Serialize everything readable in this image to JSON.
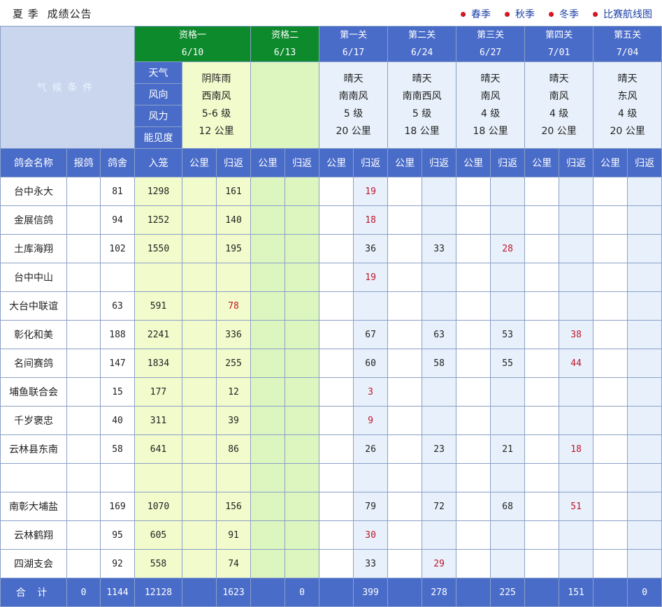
{
  "header": {
    "title_a": "夏 季",
    "title_b": "成绩公告",
    "nav": [
      "春季",
      "秋季",
      "冬季",
      "比赛航线图"
    ]
  },
  "stages": [
    {
      "name": "资格一",
      "date": "6/10"
    },
    {
      "name": "资格二",
      "date": "6/13"
    },
    {
      "name": "第一关",
      "date": "6/17"
    },
    {
      "name": "第二关",
      "date": "6/24"
    },
    {
      "name": "第三关",
      "date": "6/27"
    },
    {
      "name": "第四关",
      "date": "7/01"
    },
    {
      "name": "第五关",
      "date": "7/04"
    }
  ],
  "conditions_label": "气候条件",
  "weather_labels": [
    "天气",
    "风向",
    "风力",
    "能见度"
  ],
  "weather": [
    [
      "阴阵雨",
      "西南风",
      "5-6 级",
      "12 公里"
    ],
    [
      "",
      "",
      "",
      ""
    ],
    [
      "晴天",
      "南南风",
      "5 级",
      "20 公里"
    ],
    [
      "晴天",
      "南南西风",
      "5 级",
      "18 公里"
    ],
    [
      "晴天",
      "南风",
      "4 级",
      "18 公里"
    ],
    [
      "晴天",
      "南风",
      "4 级",
      "20 公里"
    ],
    [
      "晴天",
      "东风",
      "4 级",
      "20 公里"
    ]
  ],
  "columns": {
    "club": "鸽会名称",
    "registered": "报鸽",
    "lofts": "鸽舍",
    "entered": "入笼",
    "km": "公里",
    "returned": "归返"
  },
  "rows": [
    [
      "台中永大",
      "",
      "81",
      "1298",
      "",
      "161",
      "",
      "",
      "",
      "19",
      "",
      "",
      "",
      "",
      "",
      "",
      "",
      ""
    ],
    [
      "金展信鸽",
      "",
      "94",
      "1252",
      "",
      "140",
      "",
      "",
      "",
      "18",
      "",
      "",
      "",
      "",
      "",
      "",
      "",
      ""
    ],
    [
      "土库海翔",
      "",
      "102",
      "1550",
      "",
      "195",
      "",
      "",
      "",
      "36",
      "",
      "33",
      "",
      "28",
      "",
      "",
      "",
      ""
    ],
    [
      "台中中山",
      "",
      "",
      "",
      "",
      "",
      "",
      "",
      "",
      "19",
      "",
      "",
      "",
      "",
      "",
      "",
      "",
      ""
    ],
    [
      "大台中联谊",
      "",
      "63",
      "591",
      "",
      "78",
      "",
      "",
      "",
      "",
      "",
      "",
      "",
      "",
      "",
      "",
      "",
      ""
    ],
    [
      "彰化和美",
      "",
      "188",
      "2241",
      "",
      "336",
      "",
      "",
      "",
      "67",
      "",
      "63",
      "",
      "53",
      "",
      "38",
      "",
      ""
    ],
    [
      "名间赛鸽",
      "",
      "147",
      "1834",
      "",
      "255",
      "",
      "",
      "",
      "60",
      "",
      "58",
      "",
      "55",
      "",
      "44",
      "",
      ""
    ],
    [
      "埔鱼联合会",
      "",
      "15",
      "177",
      "",
      "12",
      "",
      "",
      "",
      "3",
      "",
      "",
      "",
      "",
      "",
      "",
      "",
      ""
    ],
    [
      "千岁褒忠",
      "",
      "40",
      "311",
      "",
      "39",
      "",
      "",
      "",
      "9",
      "",
      "",
      "",
      "",
      "",
      "",
      "",
      ""
    ],
    [
      "云林县东南",
      "",
      "58",
      "641",
      "",
      "86",
      "",
      "",
      "",
      "26",
      "",
      "23",
      "",
      "21",
      "",
      "18",
      "",
      ""
    ],
    [
      "",
      "",
      "",
      "",
      "",
      "",
      "",
      "",
      "",
      "",
      "",
      "",
      "",
      "",
      "",
      "",
      "",
      ""
    ],
    [
      "南彰大埔盐",
      "",
      "169",
      "1070",
      "",
      "156",
      "",
      "",
      "",
      "79",
      "",
      "72",
      "",
      "68",
      "",
      "51",
      "",
      ""
    ],
    [
      "云林鹤翔",
      "",
      "95",
      "605",
      "",
      "91",
      "",
      "",
      "",
      "30",
      "",
      "",
      "",
      "",
      "",
      "",
      "",
      ""
    ],
    [
      "四湖支会",
      "",
      "92",
      "558",
      "",
      "74",
      "",
      "",
      "",
      "33",
      "",
      "29",
      "",
      "",
      "",
      "",
      "",
      ""
    ]
  ],
  "red_cells": [
    [
      0,
      9
    ],
    [
      1,
      9
    ],
    [
      2,
      13
    ],
    [
      3,
      9
    ],
    [
      4,
      5
    ],
    [
      5,
      15
    ],
    [
      6,
      15
    ],
    [
      7,
      9
    ],
    [
      8,
      9
    ],
    [
      9,
      15
    ],
    [
      11,
      15
    ],
    [
      12,
      9
    ],
    [
      13,
      11
    ]
  ],
  "totals": {
    "label": "合 计",
    "values": [
      "0",
      "1144",
      "12128",
      "",
      "1623",
      "",
      "0",
      "",
      "399",
      "",
      "278",
      "",
      "225",
      "",
      "151",
      "",
      "0"
    ]
  },
  "colors": {
    "green_header": "#0c8a2c",
    "blue_header": "#4a6cc9",
    "red_value": "#c0152a",
    "nav_link": "#1b3fa5"
  }
}
